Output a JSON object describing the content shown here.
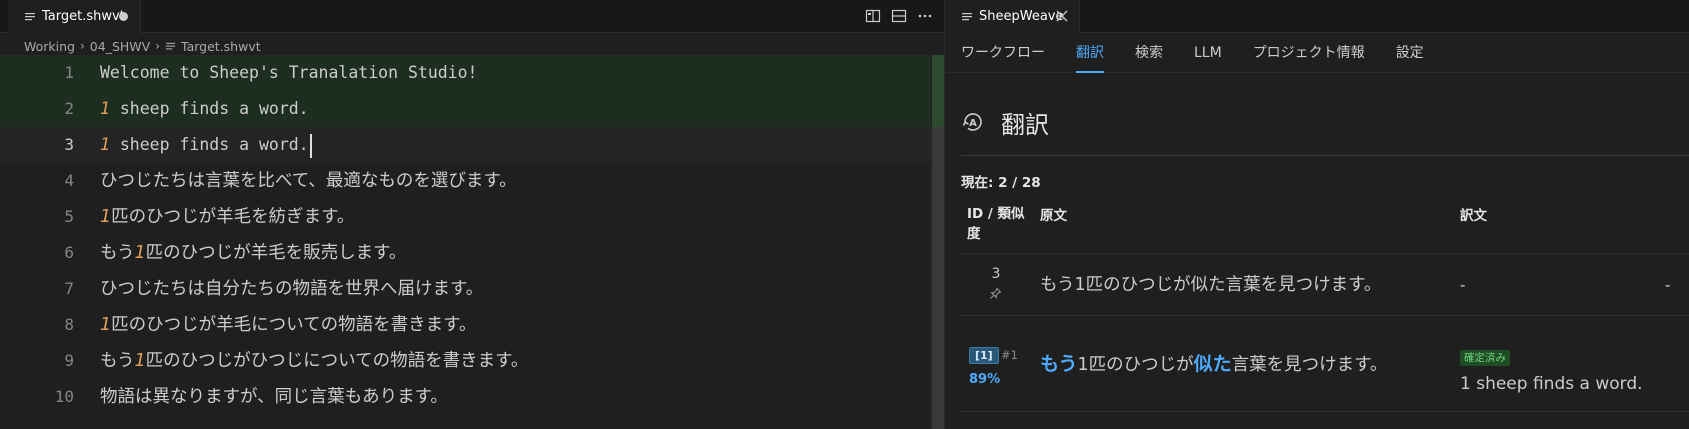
{
  "editor": {
    "tab": {
      "name": "Target.shwvt"
    },
    "breadcrumb": [
      "Working",
      "04_SHWV",
      "Target.shwvt"
    ],
    "actions": [
      "split-diff-icon",
      "split-editor-icon",
      "more-icon"
    ],
    "lines": [
      {
        "no": "1",
        "parts": [
          {
            "t": "Welcome to Sheep's Tranalation Studio!"
          }
        ]
      },
      {
        "no": "2",
        "parts": [
          {
            "t": "1",
            "num": true
          },
          {
            "t": " sheep finds a word."
          }
        ]
      },
      {
        "no": "3",
        "parts": [
          {
            "t": "1",
            "num": true
          },
          {
            "t": " sheep finds a word."
          }
        ]
      },
      {
        "no": "4",
        "parts": [
          {
            "t": "ひつじたちは言葉を比べて、最適なものを選びます。"
          }
        ]
      },
      {
        "no": "5",
        "parts": [
          {
            "t": "1",
            "num": true
          },
          {
            "t": "匹のひつじが羊毛を紡ぎます。"
          }
        ]
      },
      {
        "no": "6",
        "parts": [
          {
            "t": "もう"
          },
          {
            "t": "1",
            "num": true
          },
          {
            "t": "匹のひつじが羊毛を販売します。"
          }
        ]
      },
      {
        "no": "7",
        "parts": [
          {
            "t": "ひつじたちは自分たちの物語を世界へ届けます。"
          }
        ]
      },
      {
        "no": "8",
        "parts": [
          {
            "t": "1",
            "num": true
          },
          {
            "t": "匹のひつじが羊毛についての物語を書きます。"
          }
        ]
      },
      {
        "no": "9",
        "parts": [
          {
            "t": "もう"
          },
          {
            "t": "1",
            "num": true
          },
          {
            "t": "匹のひつじがひつじについての物語を書きます。"
          }
        ]
      },
      {
        "no": "10",
        "parts": [
          {
            "t": "物語は異なりますが、同じ言葉もあります。"
          }
        ]
      }
    ]
  },
  "panel": {
    "tab": {
      "name": "SheepWeave"
    },
    "nav": [
      "ワークフロー",
      "翻訳",
      "検索",
      "LLM",
      "プロジェクト情報",
      "設定"
    ],
    "nav_active": 1,
    "title": "翻訳",
    "progress": "現在: 2 / 28",
    "headers": {
      "id": "ID / 類似度",
      "source": "原文",
      "target": "訳文"
    },
    "current_row": {
      "id": "3",
      "source": "もう1匹のひつじが似た言葉を見つけます。",
      "target": "-",
      "extra": "-"
    },
    "match_row": {
      "badge": "[1]",
      "rank": "#1",
      "similarity": "89%",
      "source_parts": [
        {
          "t": "もう",
          "hl": true
        },
        {
          "t": "1匹のひつじが"
        },
        {
          "t": "似た",
          "hl": true
        },
        {
          "t": "言葉を見つけます。"
        }
      ],
      "status": "確定済み",
      "target": "1 sheep finds a word."
    }
  },
  "colors": {
    "accent": "#4daafc",
    "number": "#e2a05b",
    "confirmed": "#6fd27d",
    "line_highlight": "#1d2e20"
  }
}
